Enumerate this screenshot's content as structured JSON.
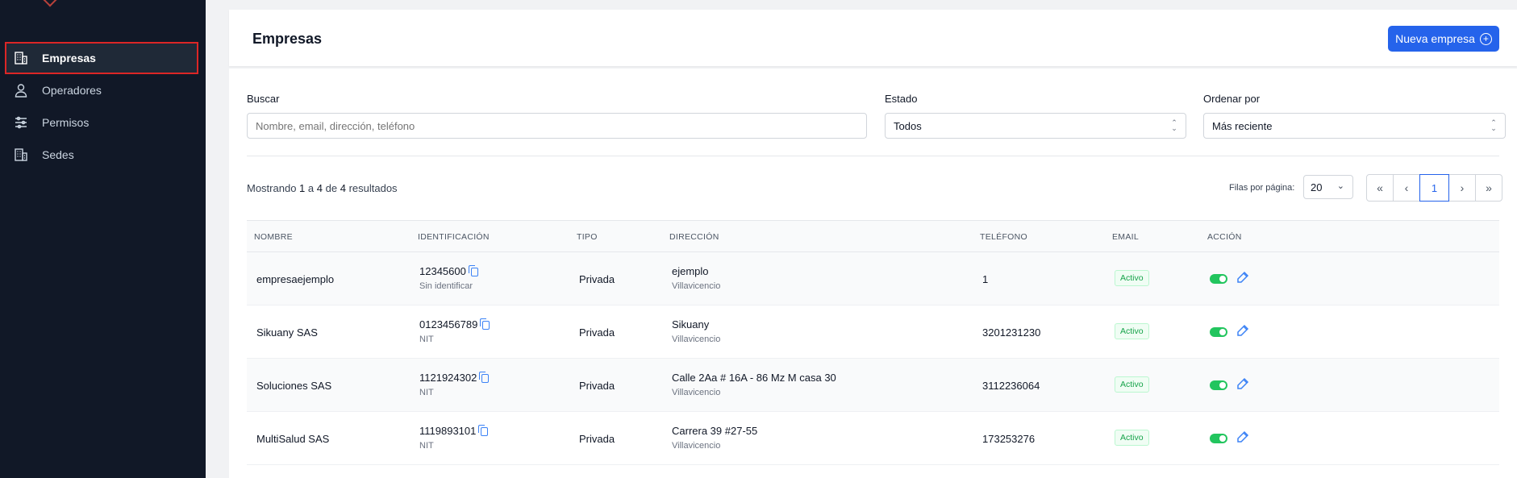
{
  "sidebar": {
    "items": [
      {
        "label": "Empresas",
        "icon": "building-icon",
        "active": true
      },
      {
        "label": "Operadores",
        "icon": "user-icon",
        "active": false
      },
      {
        "label": "Permisos",
        "icon": "sliders-icon",
        "active": false
      },
      {
        "label": "Sedes",
        "icon": "building-icon",
        "active": false
      }
    ]
  },
  "header": {
    "title": "Empresas",
    "new_button": "Nueva empresa"
  },
  "filters": {
    "search": {
      "label": "Buscar",
      "placeholder": "Nombre, email, dirección, teléfono"
    },
    "status": {
      "label": "Estado",
      "value": "Todos"
    },
    "sort": {
      "label": "Ordenar por",
      "value": "Más reciente"
    }
  },
  "results": {
    "prefix": "Mostrando",
    "from": "1",
    "to_label": "a",
    "to": "4",
    "of_label": "de",
    "total": "4",
    "suffix": "resultados"
  },
  "pagination": {
    "per_page_label": "Filas por página:",
    "per_page": "20",
    "current_page": "1"
  },
  "table": {
    "headers": [
      "NOMBRE",
      "IDENTIFICACIÓN",
      "TIPO",
      "DIRECCIÓN",
      "TELÉFONO",
      "EMAIL",
      "ACCIÓN"
    ],
    "rows": [
      {
        "name": "empresaejemplo",
        "id": "12345600",
        "id_type": "Sin identificar",
        "type": "Privada",
        "address": "ejemplo",
        "city": "Villavicencio",
        "phone": "1",
        "status": "Activo"
      },
      {
        "name": "Sikuany SAS",
        "id": "0123456789",
        "id_type": "NIT",
        "type": "Privada",
        "address": "Sikuany",
        "city": "Villavicencio",
        "phone": "3201231230",
        "status": "Activo"
      },
      {
        "name": "Soluciones SAS",
        "id": "1121924302",
        "id_type": "NIT",
        "type": "Privada",
        "address": "Calle 2Aa # 16A - 86 Mz M casa 30",
        "city": "Villavicencio",
        "phone": "3112236064",
        "status": "Activo"
      },
      {
        "name": "MultiSalud SAS",
        "id": "1119893101",
        "id_type": "NIT",
        "type": "Privada",
        "address": "Carrera 39 #27-55",
        "city": "Villavicencio",
        "phone": "173253276",
        "status": "Activo"
      }
    ]
  },
  "colors": {
    "sidebar_bg": "#111827",
    "accent": "#2563eb",
    "active_outline": "#dc2626",
    "success": "#22c55e"
  }
}
